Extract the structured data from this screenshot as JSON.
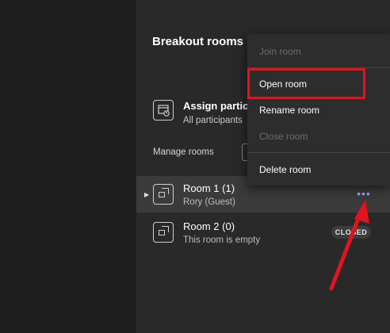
{
  "panel": {
    "title": "Breakout rooms",
    "assign": {
      "title": "Assign partic",
      "subtitle": "All participants"
    },
    "manage_label": "Manage rooms"
  },
  "rooms": [
    {
      "name": "Room 1 (1)",
      "subtitle": "Rory (Guest)",
      "more_label": "•••"
    },
    {
      "name": "Room 2 (0)",
      "subtitle": "This room is empty",
      "status": "CLOSED"
    }
  ],
  "menu": {
    "join": "Join room",
    "open": "Open room",
    "rename": "Rename room",
    "close": "Close room",
    "delete": "Delete room"
  },
  "colors": {
    "panel_bg": "#292929",
    "highlight_red": "#e0141f",
    "accent": "#9ea2ff"
  }
}
